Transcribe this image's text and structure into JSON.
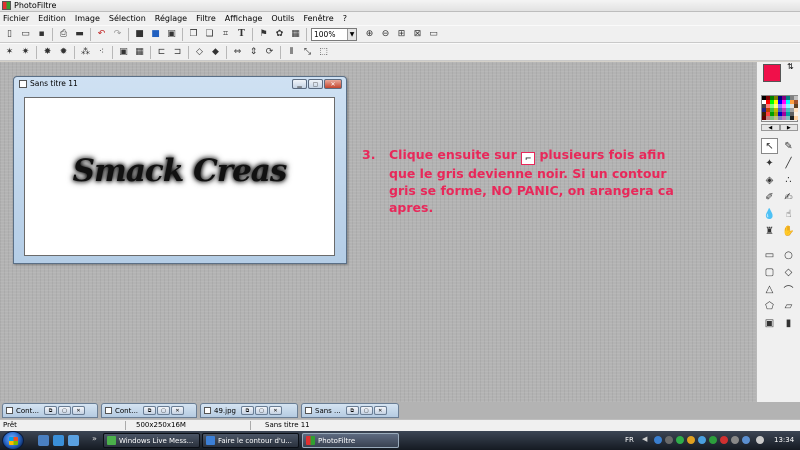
{
  "app": {
    "title": "PhotoFiltre"
  },
  "menu": [
    "Fichier",
    "Edition",
    "Image",
    "Sélection",
    "Réglage",
    "Filtre",
    "Affichage",
    "Outils",
    "Fenêtre",
    "?"
  ],
  "toolbar": {
    "zoom_value": "100%"
  },
  "document": {
    "title": "Sans titre 11",
    "canvas_text": "Smack Creas"
  },
  "instruction": {
    "number": "3.",
    "line1_before": "Clique ensuite sur",
    "line1_after": "plusieurs fois afin",
    "line2": "que le gris devienne noir. Si un contour",
    "line3": "gris se forme, NO PANIC, on arangera ca",
    "line4": "apres.",
    "color": "#e8285a"
  },
  "colors": {
    "foreground": "#f0104a",
    "background": "#ffffff"
  },
  "minimized_windows": [
    {
      "label": "Cont..."
    },
    {
      "label": "Cont..."
    },
    {
      "label": "49.jpg"
    },
    {
      "label": "Sans ..."
    }
  ],
  "status": {
    "state": "Prêt",
    "size": "500x250x16M",
    "name": "Sans titre 11"
  },
  "taskbar": {
    "tasks": [
      {
        "label": "Windows Live Mess..."
      },
      {
        "label": "Faire le contour d'u..."
      },
      {
        "label": "PhotoFiltre"
      }
    ],
    "language": "FR",
    "clock": "13:34"
  }
}
